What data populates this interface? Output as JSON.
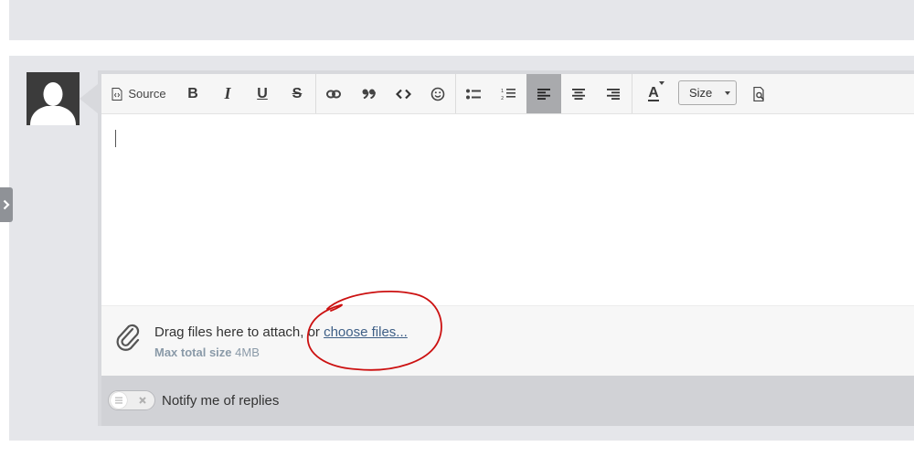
{
  "toolbar": {
    "source_label": "Source",
    "bold_label": "B",
    "italic_label": "I",
    "underline_label": "U",
    "strike_label": "S",
    "text_color_label": "A",
    "size_label": "Size",
    "active_button": "align-left"
  },
  "attachments": {
    "prompt_text": "Drag files here to attach, or ",
    "choose_link": "choose files...",
    "max_label": "Max total size",
    "max_value": "4MB"
  },
  "notify": {
    "label": "Notify me of replies",
    "enabled": false
  },
  "annotation": {
    "color": "#cc1111"
  },
  "colors": {
    "accent_link": "#3e5f86",
    "toolbar_active": "#a9aaad",
    "frame": "#d8d9dd"
  }
}
